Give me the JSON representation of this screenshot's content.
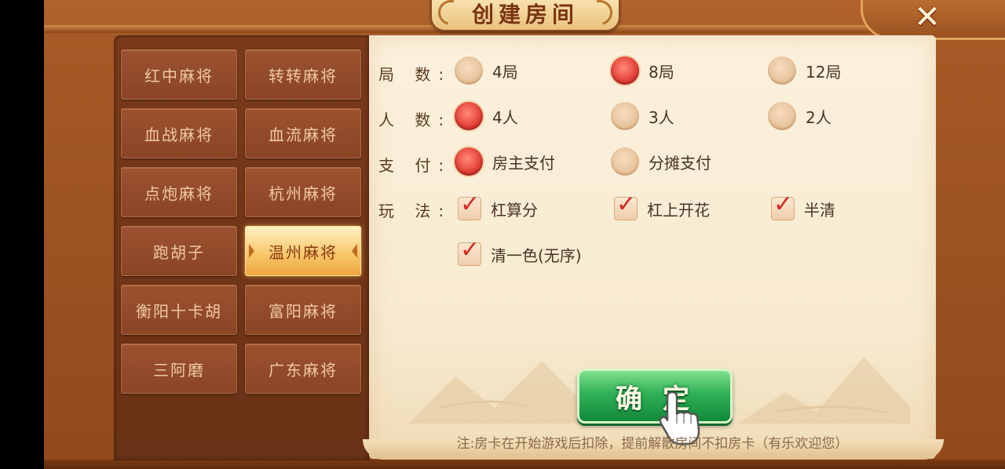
{
  "dialog": {
    "title": "创建房间",
    "close_icon": "close-icon"
  },
  "game_types": [
    {
      "label": "红中麻将",
      "selected": false
    },
    {
      "label": "转转麻将",
      "selected": false
    },
    {
      "label": "血战麻将",
      "selected": false
    },
    {
      "label": "血流麻将",
      "selected": false
    },
    {
      "label": "点炮麻将",
      "selected": false
    },
    {
      "label": "杭州麻将",
      "selected": false
    },
    {
      "label": "跑胡子",
      "selected": false
    },
    {
      "label": "温州麻将",
      "selected": true
    },
    {
      "label": "衡阳十卡胡",
      "selected": false
    },
    {
      "label": "富阳麻将",
      "selected": false
    },
    {
      "label": "三阿磨",
      "selected": false
    },
    {
      "label": "广东麻将",
      "selected": false
    }
  ],
  "settings": {
    "rounds": {
      "label": "局 数:",
      "options": [
        "4局",
        "8局",
        "12局"
      ],
      "selected": "8局"
    },
    "players": {
      "label": "人 数:",
      "options": [
        "4人",
        "3人",
        "2人"
      ],
      "selected": "4人"
    },
    "payment": {
      "label": "支 付:",
      "options": [
        "房主支付",
        "分摊支付"
      ],
      "selected": "房主支付"
    },
    "rules": {
      "label": "玩 法:",
      "options": [
        "杠算分",
        "杠上开花",
        "半清",
        "清一色(无序)"
      ],
      "checked": [
        "杠算分",
        "杠上开花",
        "半清",
        "清一色(无序)"
      ]
    }
  },
  "confirm_label": "确定",
  "note": "注:房卡在开始游戏后扣除，提前解散房间不扣房卡（有乐欢迎您）",
  "colors": {
    "selected_radio": "#e5443a",
    "confirm_green": "#2fb156",
    "frame_brown": "#9a4f1e"
  }
}
